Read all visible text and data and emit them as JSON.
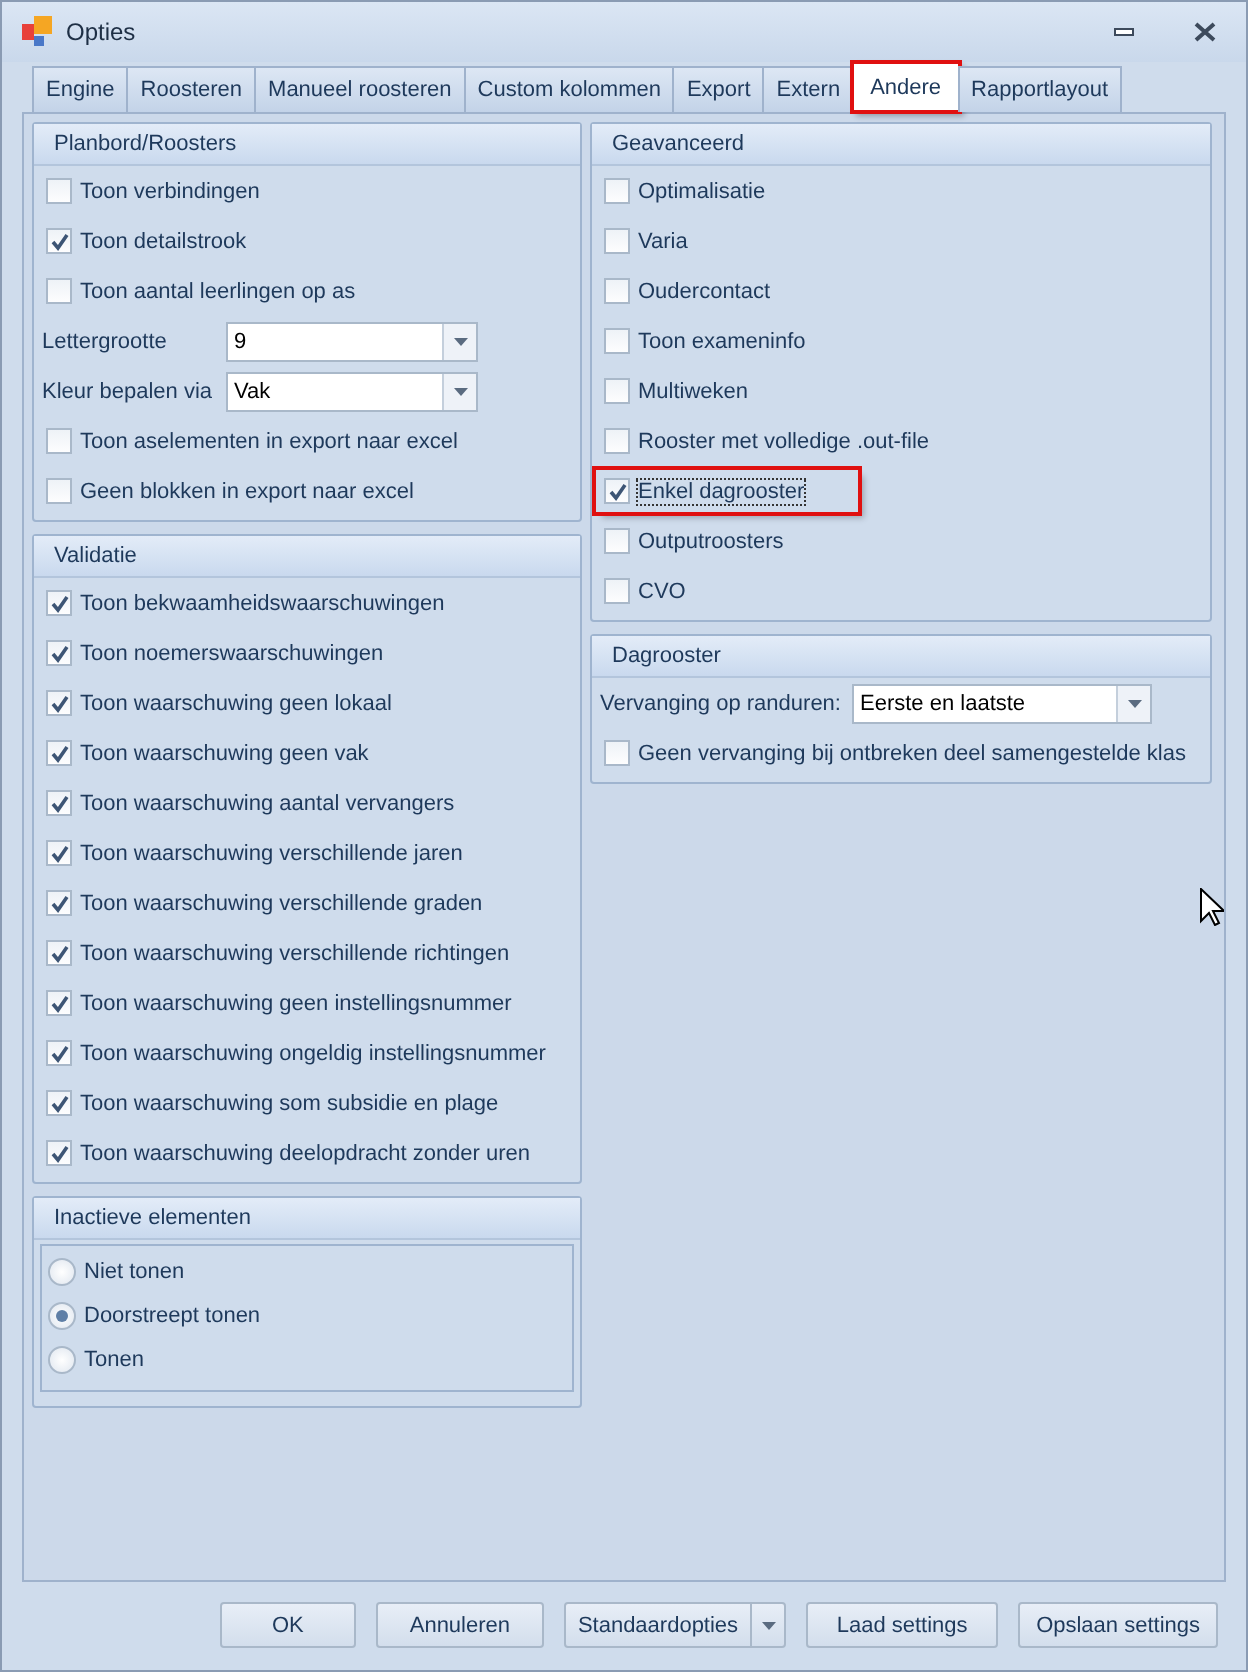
{
  "window": {
    "title": "Opties"
  },
  "tabs": [
    {
      "label": "Engine",
      "selected": false,
      "highlighted": false
    },
    {
      "label": "Roosteren",
      "selected": false,
      "highlighted": false
    },
    {
      "label": "Manueel roosteren",
      "selected": false,
      "highlighted": false
    },
    {
      "label": "Custom kolommen",
      "selected": false,
      "highlighted": false
    },
    {
      "label": "Export",
      "selected": false,
      "highlighted": false
    },
    {
      "label": "Extern",
      "selected": false,
      "highlighted": false
    },
    {
      "label": "Andere",
      "selected": true,
      "highlighted": true
    },
    {
      "label": "Rapportlayout",
      "selected": false,
      "highlighted": false
    }
  ],
  "left_column": [
    {
      "title": "Planbord/Roosters",
      "kind": "options",
      "items": [
        {
          "kind": "checkbox",
          "label": "Toon verbindingen",
          "checked": false
        },
        {
          "kind": "checkbox",
          "label": "Toon detailstrook",
          "checked": true
        },
        {
          "kind": "checkbox",
          "label": "Toon aantal leerlingen op as",
          "checked": false
        },
        {
          "kind": "select",
          "label": "Lettergrootte",
          "value": "9"
        },
        {
          "kind": "select",
          "label": "Kleur bepalen via",
          "value": "Vak"
        },
        {
          "kind": "checkbox",
          "label": "Toon aselementen in export naar excel",
          "checked": false
        },
        {
          "kind": "checkbox",
          "label": "Geen blokken in export naar excel",
          "checked": false
        }
      ]
    },
    {
      "title": "Validatie",
      "kind": "options",
      "items": [
        {
          "kind": "checkbox",
          "label": "Toon bekwaamheidswaarschuwingen",
          "checked": true
        },
        {
          "kind": "checkbox",
          "label": "Toon noemerswaarschuwingen",
          "checked": true
        },
        {
          "kind": "checkbox",
          "label": "Toon waarschuwing geen lokaal",
          "checked": true
        },
        {
          "kind": "checkbox",
          "label": "Toon waarschuwing geen vak",
          "checked": true
        },
        {
          "kind": "checkbox",
          "label": "Toon waarschuwing aantal vervangers",
          "checked": true
        },
        {
          "kind": "checkbox",
          "label": "Toon waarschuwing verschillende jaren",
          "checked": true
        },
        {
          "kind": "checkbox",
          "label": "Toon waarschuwing verschillende graden",
          "checked": true
        },
        {
          "kind": "checkbox",
          "label": "Toon waarschuwing verschillende richtingen",
          "checked": true
        },
        {
          "kind": "checkbox",
          "label": "Toon waarschuwing geen instellingsnummer",
          "checked": true
        },
        {
          "kind": "checkbox",
          "label": "Toon waarschuwing ongeldig instellingsnummer",
          "checked": true
        },
        {
          "kind": "checkbox",
          "label": "Toon waarschuwing som subsidie en plage",
          "checked": true
        },
        {
          "kind": "checkbox",
          "label": "Toon waarschuwing deelopdracht zonder uren",
          "checked": true
        }
      ]
    },
    {
      "title": "Inactieve elementen",
      "kind": "choice",
      "items": [
        {
          "kind": "radio",
          "label": "Niet tonen",
          "selected": false
        },
        {
          "kind": "radio",
          "label": "Doorstreept tonen",
          "selected": true
        },
        {
          "kind": "radio",
          "label": "Tonen",
          "selected": false
        }
      ]
    }
  ],
  "right_column": [
    {
      "title": "Geavanceerd",
      "kind": "options",
      "items": [
        {
          "kind": "checkbox",
          "label": "Optimalisatie",
          "checked": false
        },
        {
          "kind": "checkbox",
          "label": "Varia",
          "checked": false
        },
        {
          "kind": "checkbox",
          "label": "Oudercontact",
          "checked": false
        },
        {
          "kind": "checkbox",
          "label": "Toon exameninfo",
          "checked": false
        },
        {
          "kind": "checkbox",
          "label": "Multiweken",
          "checked": false
        },
        {
          "kind": "checkbox",
          "label": "Rooster met volledige .out-file",
          "checked": false
        },
        {
          "kind": "checkbox",
          "label": "Enkel dagrooster",
          "checked": true,
          "focused": true,
          "highlighted": true
        },
        {
          "kind": "checkbox",
          "label": "Outputroosters",
          "checked": false
        },
        {
          "kind": "checkbox",
          "label": "CVO",
          "checked": false
        }
      ]
    },
    {
      "title": "Dagrooster",
      "kind": "options",
      "items": [
        {
          "kind": "select",
          "label": "Vervanging op randuren:",
          "value": "Eerste en laatste"
        },
        {
          "kind": "checkbox",
          "label": "Geen vervanging bij ontbreken deel samengestelde klas",
          "checked": false
        }
      ]
    }
  ],
  "buttons": [
    {
      "kind": "button",
      "label": "OK"
    },
    {
      "kind": "button",
      "label": "Annuleren"
    },
    {
      "kind": "split",
      "label": "Standaardopties"
    },
    {
      "kind": "button",
      "label": "Laad settings"
    },
    {
      "kind": "button",
      "label": "Opslaan settings"
    }
  ]
}
